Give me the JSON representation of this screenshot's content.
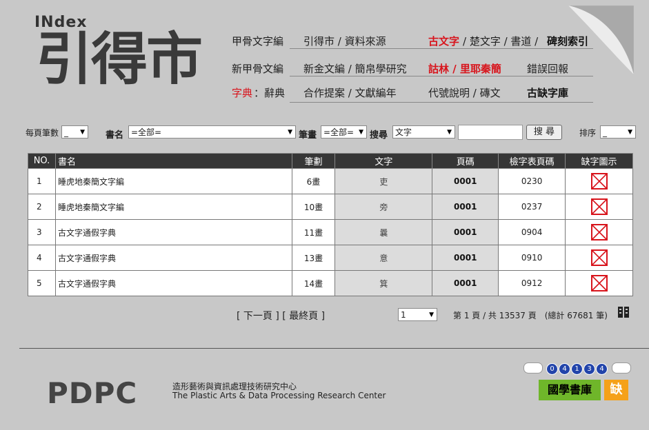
{
  "logo": {
    "word": "INdex",
    "mark": "引得市"
  },
  "nav": {
    "row1": [
      "甲骨文字編",
      "引得市 / 資料來源",
      "古文字",
      " / 楚文字 / 書道 / ",
      "碑刻索引"
    ],
    "row2": [
      "新甲骨文編",
      "新金文編 / 簡帛學研究",
      "詁林 / 里耶秦簡",
      "錯誤回報"
    ],
    "row3": [
      "字典",
      "：辭典",
      "合作提案 / 文獻編年",
      "代號說明 / 磚文",
      "古缺字庫"
    ]
  },
  "search": {
    "per_page_label": "每頁筆數",
    "per_page_value": "_",
    "book_label": "書名",
    "book_value": "=全部=",
    "stroke_label": "筆畫",
    "stroke_value": "=全部=",
    "search_label": "搜尋",
    "search_type": "文字",
    "search_button": "搜 尋",
    "sort_label": "排序",
    "sort_value": "_"
  },
  "table": {
    "headers": [
      "NO.",
      "書名",
      "筆劃",
      "文字",
      "頁碼",
      "檢字表頁碼",
      "缺字圖示"
    ],
    "rows": [
      {
        "no": "1",
        "name": "睡虎地秦簡文字編",
        "strokes": "6畫",
        "char": "吏",
        "page": "0001",
        "index_page": "0230"
      },
      {
        "no": "2",
        "name": "睡虎地秦簡文字編",
        "strokes": "10畫",
        "char": "旁",
        "page": "0001",
        "index_page": "0237"
      },
      {
        "no": "3",
        "name": "古文字通假字典",
        "strokes": "11畫",
        "char": "曩",
        "page": "0001",
        "index_page": "0904"
      },
      {
        "no": "4",
        "name": "古文字通假字典",
        "strokes": "13畫",
        "char": "意",
        "page": "0001",
        "index_page": "0910"
      },
      {
        "no": "5",
        "name": "古文字通假字典",
        "strokes": "14畫",
        "char": "箕",
        "page": "0001",
        "index_page": "0912"
      }
    ]
  },
  "pager": {
    "next": "[ 下一頁 ]",
    "last": "[ 最終頁 ]",
    "page_select": "1",
    "info": "第 1 頁 / 共 13537 頁　(總計 67681 筆)"
  },
  "footer": {
    "brand": "PDPC",
    "name_zh": "造形藝術與資訊處理技術研究中心",
    "name_en": "The Plastic Arts & Data Processing Research Center",
    "counter": [
      "0",
      "4",
      "1",
      "3",
      "4"
    ],
    "lib_logo": "國學書庫",
    "que_logo": "缺"
  },
  "colors": {
    "accent_red": "#d8141c",
    "header_bg": "#363636",
    "page_bg": "#c8c8c8"
  }
}
